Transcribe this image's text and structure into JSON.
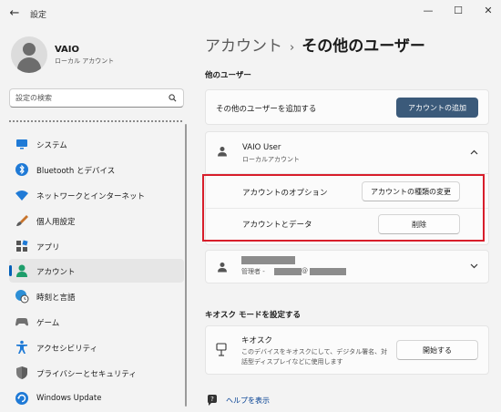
{
  "window": {
    "title": "設定",
    "back_glyph": "←",
    "min_glyph": "—",
    "max_glyph": "☐",
    "close_glyph": "✕"
  },
  "profile": {
    "name": "VAIO",
    "account_type": "ローカル アカウント"
  },
  "search": {
    "placeholder": "設定の検索"
  },
  "nav": {
    "items": [
      {
        "label": "システム",
        "icon": "system-icon"
      },
      {
        "label": "Bluetooth とデバイス",
        "icon": "bluetooth-icon"
      },
      {
        "label": "ネットワークとインターネット",
        "icon": "wifi-icon"
      },
      {
        "label": "個人用設定",
        "icon": "brush-icon"
      },
      {
        "label": "アプリ",
        "icon": "apps-icon"
      },
      {
        "label": "アカウント",
        "icon": "account-icon",
        "active": true
      },
      {
        "label": "時刻と言語",
        "icon": "globe-clock-icon"
      },
      {
        "label": "ゲーム",
        "icon": "gamepad-icon"
      },
      {
        "label": "アクセシビリティ",
        "icon": "accessibility-icon"
      },
      {
        "label": "プライバシーとセキュリティ",
        "icon": "shield-icon"
      },
      {
        "label": "Windows Update",
        "icon": "update-icon"
      }
    ]
  },
  "breadcrumb": {
    "parent": "アカウント",
    "separator": "›",
    "current": "その他のユーザー"
  },
  "other_users": {
    "section_title": "他のユーザー",
    "add_label": "その他のユーザーを追加する",
    "add_button": "アカウントの追加",
    "user1": {
      "name": "VAIO User",
      "type": "ローカルアカウント",
      "options_label": "アカウントのオプション",
      "change_type_button": "アカウントの種類の変更",
      "data_label": "アカウントとデータ",
      "delete_button": "削除"
    },
    "user2": {
      "role_prefix": "管理者 -",
      "at": "@"
    }
  },
  "kiosk": {
    "section_title": "キオスク モードを設定する",
    "title": "キオスク",
    "desc_line1": "このデバイスをキオスクにして、デジタル署名、対",
    "desc_line2": "話型ディスプレイなどに使用します",
    "start_button": "開始する"
  },
  "help": {
    "label": "ヘルプを表示"
  },
  "colors": {
    "accent": "#005fb8",
    "primary_button": "#3b5a7a",
    "highlight_box": "#d81e2b"
  }
}
